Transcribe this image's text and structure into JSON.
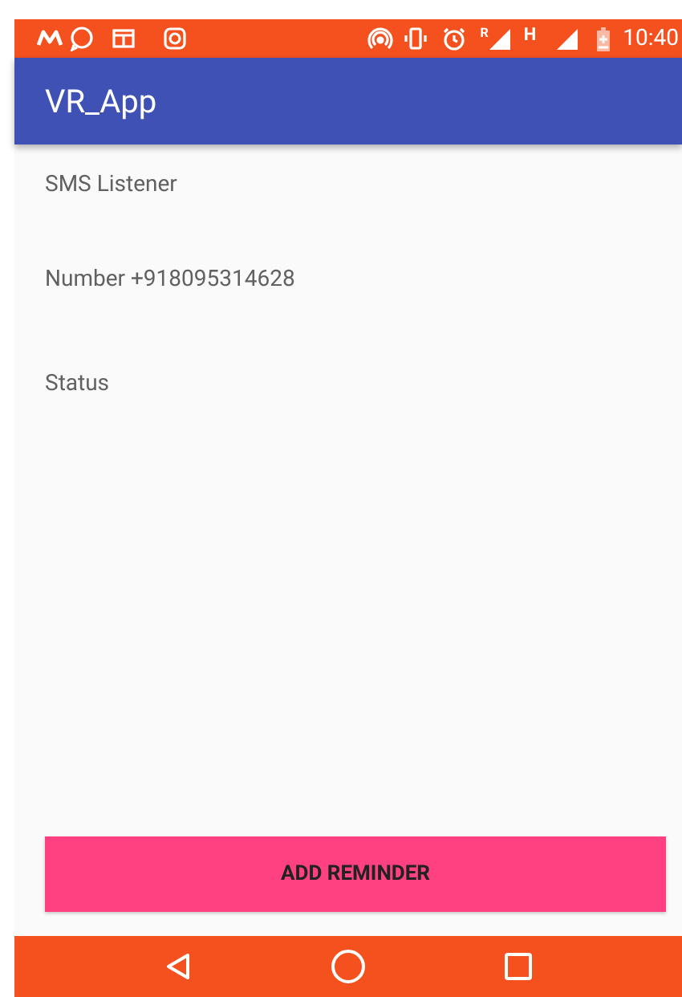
{
  "status_bar": {
    "network_letter": "R",
    "network_type": "H",
    "time": "10:40"
  },
  "app_bar": {
    "title": "VR_App"
  },
  "content": {
    "lines": [
      "SMS Listener",
      "Number +918095314628",
      "Status"
    ]
  },
  "button": {
    "label": "ADD REMINDER"
  }
}
